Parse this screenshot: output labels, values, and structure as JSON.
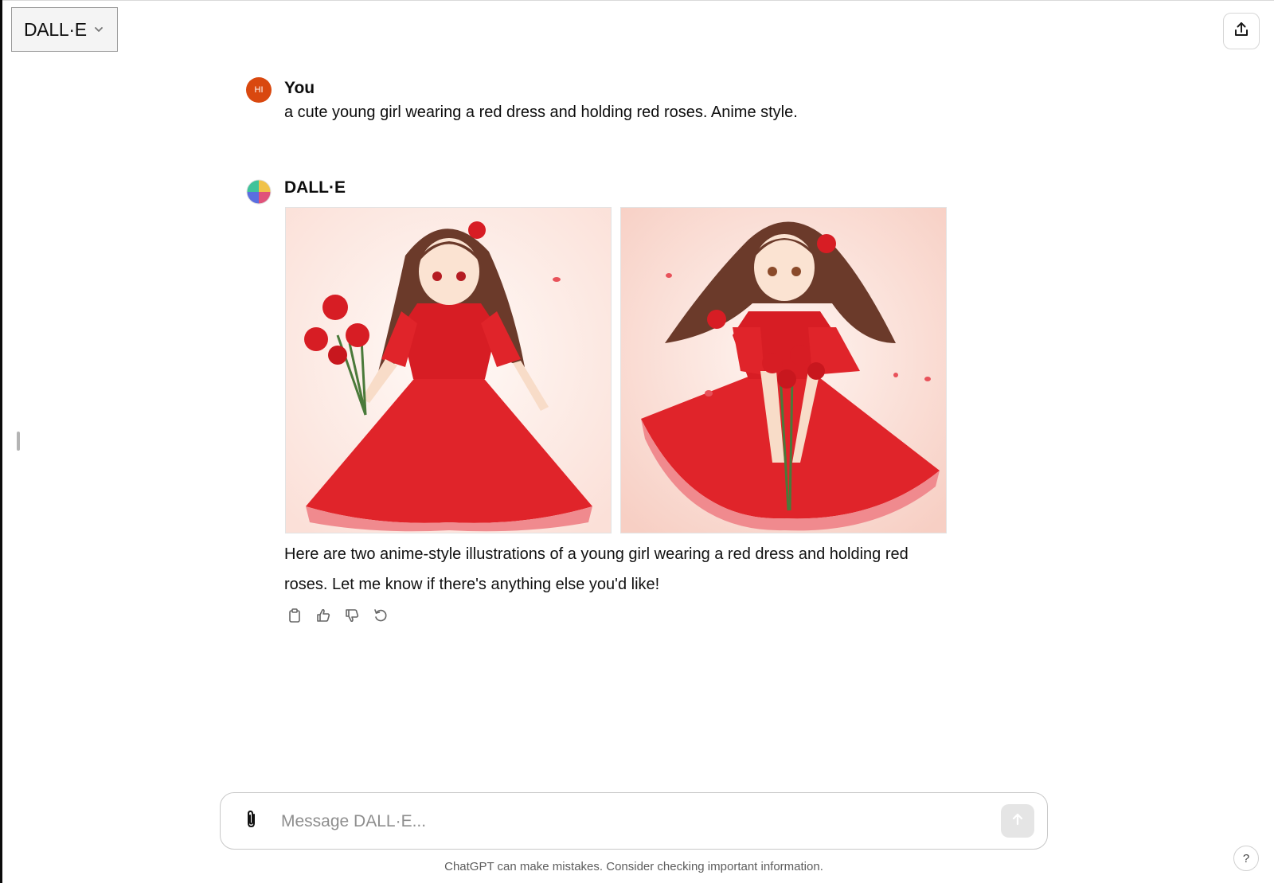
{
  "header": {
    "model_name": "DALL·E",
    "model_icon": "chevron-down-icon",
    "share_icon": "share-icon"
  },
  "conversation": {
    "user": {
      "avatar_initials": "HI",
      "author": "You",
      "text": "a cute young girl wearing a red dress and holding red roses. Anime style."
    },
    "assistant": {
      "author": "DALL·E",
      "avatar_icon": "dalle-color-wheel-icon",
      "images": [
        {
          "name": "generated-image-1",
          "description": "anime girl in red dress holding roses bouquet at side"
        },
        {
          "name": "generated-image-2",
          "description": "anime girl in red dress holding roses at front"
        }
      ],
      "text": "Here are two anime-style illustrations of a young girl wearing a red dress and holding red roses. Let me know if there's anything else you'd like!",
      "actions": [
        {
          "name": "copy-button",
          "icon": "clipboard-icon"
        },
        {
          "name": "thumbs-up-button",
          "icon": "thumbs-up-icon"
        },
        {
          "name": "thumbs-down-button",
          "icon": "thumbs-down-icon"
        },
        {
          "name": "regenerate-button",
          "icon": "regenerate-icon"
        }
      ]
    }
  },
  "composer": {
    "placeholder": "Message DALL·E...",
    "value": "",
    "attach_icon": "paperclip-icon",
    "send_icon": "arrow-up-icon"
  },
  "footer": {
    "disclaimer": "ChatGPT can make mistakes. Consider checking important information.",
    "help_label": "?"
  },
  "colors": {
    "user_avatar": "#d9480f",
    "dress_red": "#e0242a",
    "image_background": "#fbe4de"
  }
}
